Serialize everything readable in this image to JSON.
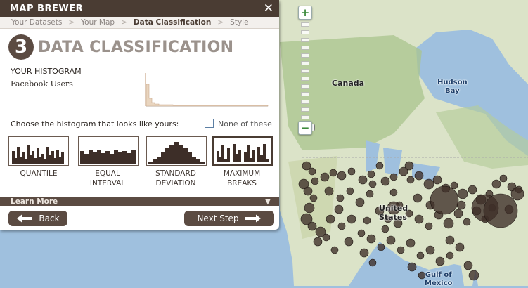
{
  "window": {
    "title": "MAP BREWER",
    "close_glyph": "✕"
  },
  "breadcrumbs": [
    "Your Datasets",
    "Your Map",
    "Data Classification",
    "Style"
  ],
  "breadcrumb_active": "Data Classification",
  "breadcrumb_separator": ">",
  "step": {
    "number": "3",
    "title": "DATA CLASSIFICATION"
  },
  "histogram": {
    "label": "YOUR HISTOGRAM",
    "dataset": "Facebook Users"
  },
  "choose_prompt": "Choose the histogram that looks like yours:",
  "none_option": {
    "label": "None of these",
    "checked": false
  },
  "histogram_options": [
    {
      "line1": "QUANTILE",
      "line2": "",
      "selected": false
    },
    {
      "line1": "EQUAL",
      "line2": "INTERVAL",
      "selected": false
    },
    {
      "line1": "STANDARD",
      "line2": "DEVIATION",
      "selected": false
    },
    {
      "line1": "MAXIMUM",
      "line2": "BREAKS",
      "selected": true
    }
  ],
  "learn_more": {
    "label": "Learn More",
    "chevron": "▼"
  },
  "buttons": {
    "back": "Back",
    "next": "Next Step"
  },
  "map": {
    "labels": {
      "canada": "Canada",
      "hudson_line1": "Hudson",
      "hudson_line2": "Bay",
      "us_line1": "United",
      "us_line2": "States",
      "gulf_line1": "Gulf of",
      "gulf_line2": "Mexico"
    },
    "zoom_in": "+",
    "zoom_out": "−"
  },
  "colors": {
    "brand_brown": "#4a3c33",
    "accent_brown": "#5b4b42",
    "marker": "#3d2e28",
    "water": "#9fc0de",
    "land": "#dbe3c8"
  }
}
